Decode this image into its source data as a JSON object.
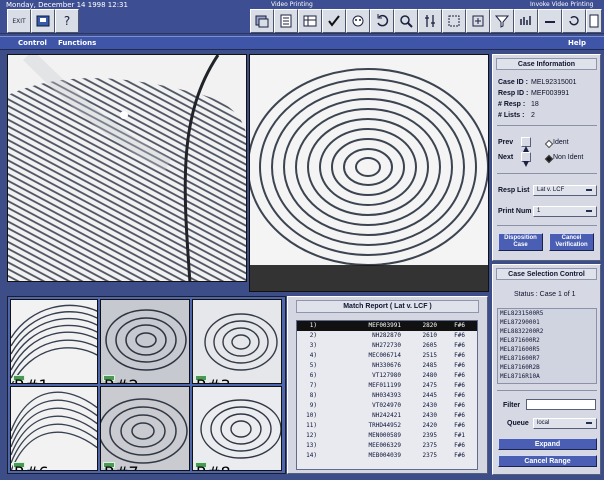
{
  "datetime": "Monday, December 14 1998 12:31",
  "titles": {
    "left": "Video Printing",
    "right": "Invoke Video Printing"
  },
  "icons": [
    "exit-icon",
    "printer-icon",
    "question-icon",
    "stack-icon",
    "document-icon",
    "table-icon",
    "checkmark-icon",
    "face-icon",
    "rotate-icon",
    "magnify-icon",
    "ruler-icon",
    "select-icon",
    "zoom-icon",
    "filter-icon",
    "bars-icon",
    "dash-icon",
    "refresh-icon",
    "menu-icon",
    "card-icon"
  ],
  "tool_labels": {
    "exit": "EXIT",
    "printer": "",
    "question": "?"
  },
  "menu": {
    "control": "Control",
    "functions": "Functions",
    "help": "Help"
  },
  "case": {
    "title": "Case Information",
    "case_id_label": "Case ID :",
    "case_id": "MEL92315001",
    "resp_id_label": "Resp ID :",
    "resp_id": "MEF003991",
    "resp_label": "# Resp :",
    "resp": "18",
    "lists_label": "# Lists :",
    "lists": "2",
    "prev": "Prev",
    "next": "Next",
    "ident": "Ident",
    "non_ident": "Non Ident",
    "resp_list_label": "Resp List",
    "resp_list_value": "Lat v. LCF",
    "print_num_label": "Print Num",
    "print_num_value": "1",
    "disposition": "Disposition Case",
    "cancel_verification": "Cancel Verification"
  },
  "selection": {
    "title": "Case Selection Control",
    "status": "Status : Case 1 of 1",
    "cases": [
      "MEL8231500R5",
      "MEL87290001",
      "MEL8832200R2",
      "MEL871600R2",
      "MEL871600R5",
      "MEL871600R7",
      "MEL87160R2B",
      "MEL8716R10A"
    ],
    "filter_label": "Filter",
    "queue_label": "Queue",
    "queue_value": "local",
    "expand": "Expand",
    "cancel_range": "Cancel Range"
  },
  "match": {
    "title": "Match Report ( Lat v. LCF )",
    "rows": [
      {
        "n": "1)",
        "id": "MEF003991",
        "score": "2820",
        "code": "F#6"
      },
      {
        "n": "2)",
        "id": "NH282870",
        "score": "2610",
        "code": "F#6"
      },
      {
        "n": "3)",
        "id": "NH272730",
        "score": "2605",
        "code": "F#6"
      },
      {
        "n": "4)",
        "id": "MEC006714",
        "score": "2515",
        "code": "F#6"
      },
      {
        "n": "5)",
        "id": "NH330676",
        "score": "2485",
        "code": "F#6"
      },
      {
        "n": "6)",
        "id": "VT127980",
        "score": "2480",
        "code": "F#6"
      },
      {
        "n": "7)",
        "id": "MEF011199",
        "score": "2475",
        "code": "F#6"
      },
      {
        "n": "8)",
        "id": "NH034393",
        "score": "2445",
        "code": "F#6"
      },
      {
        "n": "9)",
        "id": "VT024970",
        "score": "2430",
        "code": "F#6"
      },
      {
        "n": "10)",
        "id": "NH242421",
        "score": "2430",
        "code": "F#6"
      },
      {
        "n": "11)",
        "id": "TRHD44952",
        "score": "2420",
        "code": "F#6"
      },
      {
        "n": "12)",
        "id": "MEN000589",
        "score": "2395",
        "code": "F#1"
      },
      {
        "n": "13)",
        "id": "MEE006329",
        "score": "2375",
        "code": "F#6"
      },
      {
        "n": "14)",
        "id": "MEB004039",
        "score": "2375",
        "code": "F#6"
      }
    ]
  },
  "thumb_tags": [
    "R#1",
    "R#2",
    "R#3",
    "R#6",
    "R#7",
    "R#8"
  ]
}
